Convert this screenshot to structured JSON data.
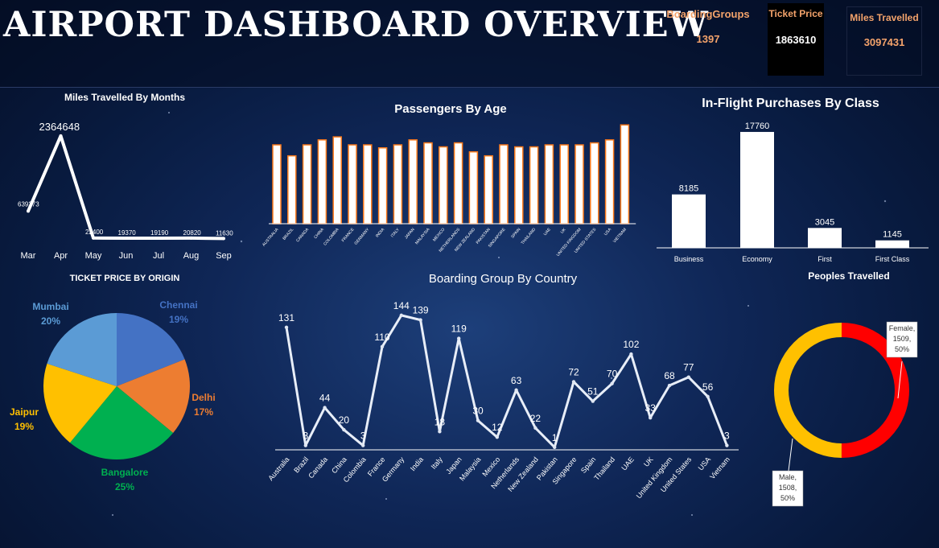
{
  "header": {
    "title": "AIRPORT DASHBOARD OVERVIEW",
    "kpis": [
      {
        "label": "BoardingGroups",
        "value": "1397"
      },
      {
        "label": "Ticket Price",
        "value": "1863610"
      },
      {
        "label": "Miles Travelled",
        "value": "3097431"
      }
    ]
  },
  "colors": {
    "accent": "#f4a36b",
    "background": "#0d2150"
  },
  "chart_data": [
    {
      "id": "miles",
      "type": "line",
      "title": "Miles Travelled By Months",
      "categories": [
        "Mar",
        "Apr",
        "May",
        "Jun",
        "Jul",
        "Aug",
        "Sep"
      ],
      "values": [
        639273,
        2364648,
        22400,
        19370,
        19190,
        20820,
        11630
      ],
      "data_labels": [
        "639273",
        "2364648",
        "22400",
        "19370",
        "19190",
        "20820",
        "11630"
      ],
      "ylim": [
        0,
        2400000
      ]
    },
    {
      "id": "age",
      "type": "bar",
      "title": "Passengers By Age",
      "categories": [
        "AUSTRALIA",
        "BRAZIL",
        "CANADA",
        "CHINA",
        "COLOMBIA",
        "FRANCE",
        "GERMANY",
        "INDIA",
        "ITALY",
        "JAPAN",
        "MALAYSIA",
        "MEXICO",
        "NETHERLANDS",
        "NEW ZEALAND",
        "PAKISTAN",
        "SINGAPORE",
        "SPAIN",
        "THAILAND",
        "UAE",
        "UK",
        "UNITED KINGDOM",
        "UNITED STATES",
        "USA",
        "VIETNAM"
      ],
      "values": [
        79,
        68,
        79,
        84,
        87,
        79,
        79,
        76,
        79,
        84,
        81,
        77,
        81,
        72,
        68,
        79,
        77,
        77,
        79,
        79,
        79,
        81,
        84,
        99
      ],
      "ylim": [
        0,
        100
      ]
    },
    {
      "id": "class",
      "type": "bar",
      "title": "In-Flight Purchases By Class",
      "categories": [
        "Business",
        "Economy",
        "First",
        "First Class"
      ],
      "values": [
        8185,
        17760,
        3045,
        1145
      ],
      "ylim": [
        0,
        18000
      ]
    },
    {
      "id": "origin",
      "type": "pie",
      "title": "TICKET PRICE BY ORIGIN",
      "slices": [
        {
          "label": "Chennai",
          "percent": "19%",
          "value": 19,
          "color": "#4472c4"
        },
        {
          "label": "Delhi",
          "percent": "17%",
          "value": 17,
          "color": "#ed7d31"
        },
        {
          "label": "Bangalore",
          "percent": "25%",
          "value": 25,
          "color": "#00b050"
        },
        {
          "label": "Jaipur",
          "percent": "19%",
          "value": 19,
          "color": "#ffc000"
        },
        {
          "label": "Mumbai",
          "percent": "20%",
          "value": 20,
          "color": "#5b9bd5"
        }
      ]
    },
    {
      "id": "boarding",
      "type": "line",
      "title": "Boarding Group By Country",
      "categories": [
        "Australia",
        "Brazil",
        "Canada",
        "China",
        "Colombia",
        "France",
        "Germany",
        "India",
        "Italy",
        "Japan",
        "Malaysia",
        "Mexico",
        "Netherlands",
        "New Zealand",
        "Pakistan",
        "Singapore",
        "Spain",
        "Thailand",
        "UAE",
        "UK",
        "United Kingdom",
        "United States",
        "USA",
        "Vietnam"
      ],
      "values": [
        131,
        3,
        44,
        20,
        3,
        110,
        144,
        139,
        18,
        119,
        30,
        12,
        63,
        22,
        1,
        72,
        51,
        70,
        102,
        33,
        68,
        77,
        56,
        3
      ],
      "ylim": [
        0,
        150
      ]
    },
    {
      "id": "gender",
      "type": "pie",
      "title": "Peoples Travelled",
      "slices": [
        {
          "label": "Female",
          "value": 1509,
          "percent": "50%",
          "color": "#ff0000"
        },
        {
          "label": "Male",
          "value": 1508,
          "percent": "50%",
          "color": "#ffc000"
        }
      ],
      "callouts": [
        "Female,",
        "1509,",
        "50%",
        "Male,",
        "1508,",
        "50%"
      ]
    }
  ]
}
